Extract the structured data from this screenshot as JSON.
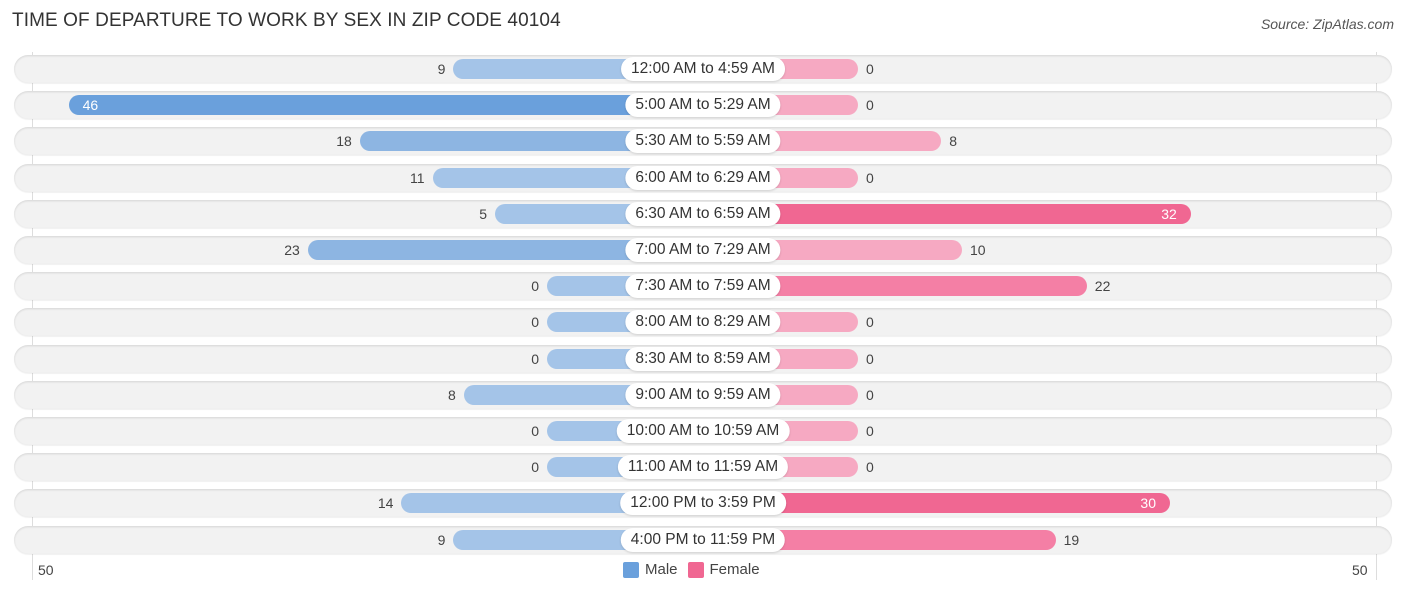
{
  "title": "TIME OF DEPARTURE TO WORK BY SEX IN ZIP CODE 40104",
  "source": "Source: ZipAtlas.com",
  "colors": {
    "male": "#6aa0dc",
    "male_light": "#a4c4e8",
    "female": "#f06792",
    "female_light": "#f6a9c2"
  },
  "legend": {
    "male": "Male",
    "female": "Female"
  },
  "axis": {
    "left_label": "50",
    "right_label": "50"
  },
  "chart_data": {
    "type": "bar",
    "orientation": "horizontal-diverging",
    "title": "TIME OF DEPARTURE TO WORK BY SEX IN ZIP CODE 40104",
    "categories": [
      "12:00 AM to 4:59 AM",
      "5:00 AM to 5:29 AM",
      "5:30 AM to 5:59 AM",
      "6:00 AM to 6:29 AM",
      "6:30 AM to 6:59 AM",
      "7:00 AM to 7:29 AM",
      "7:30 AM to 7:59 AM",
      "8:00 AM to 8:29 AM",
      "8:30 AM to 8:59 AM",
      "9:00 AM to 9:59 AM",
      "10:00 AM to 10:59 AM",
      "11:00 AM to 11:59 AM",
      "12:00 PM to 3:59 PM",
      "4:00 PM to 11:59 PM"
    ],
    "series": [
      {
        "name": "Male",
        "values": [
          9,
          46,
          18,
          11,
          5,
          23,
          0,
          0,
          0,
          8,
          0,
          0,
          14,
          9
        ]
      },
      {
        "name": "Female",
        "values": [
          0,
          0,
          8,
          0,
          32,
          10,
          22,
          0,
          0,
          0,
          0,
          0,
          30,
          19
        ]
      }
    ],
    "xlim": [
      -50,
      50
    ],
    "tick_labels": [
      "50",
      "50"
    ],
    "legend_position": "bottom-center"
  }
}
